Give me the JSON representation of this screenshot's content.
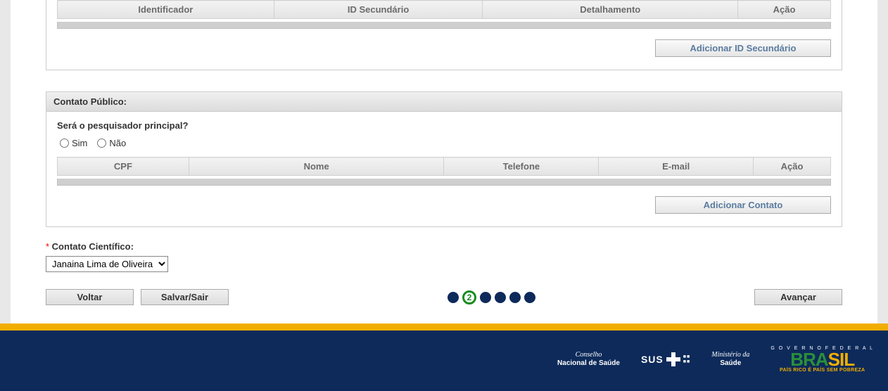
{
  "topTable": {
    "headers": [
      "Identificador",
      "ID Secundário",
      "Detalhamento",
      "Ação"
    ],
    "addButton": "Adicionar ID Secundário"
  },
  "publicContact": {
    "sectionTitle": "Contato Público:",
    "question": "Será o pesquisador principal?",
    "radioYes": "Sim",
    "radioNo": "Não",
    "tableHeaders": [
      "CPF",
      "Nome",
      "Telefone",
      "E-mail",
      "Ação"
    ],
    "addButton": "Adicionar Contato"
  },
  "scientificContact": {
    "label": "Contato Científico:",
    "selected": "Janaina Lima de Oliveira"
  },
  "nav": {
    "back": "Voltar",
    "saveExit": "Salvar/Sair",
    "advance": "Avançar",
    "currentStep": "2"
  },
  "footer": {
    "conselhoTop": "Conselho",
    "conselhoBot": "Nacional de Saúde",
    "sus": "SUS",
    "ministerioTop": "Ministério da",
    "ministerioBot": "Saúde",
    "governoTop": "G O V E R N O   F E D E R A L",
    "brasil1": "BRA",
    "brasil2": "SIL",
    "governoBot": "PAÍS RICO É PAÍS SEM POBREZA"
  }
}
